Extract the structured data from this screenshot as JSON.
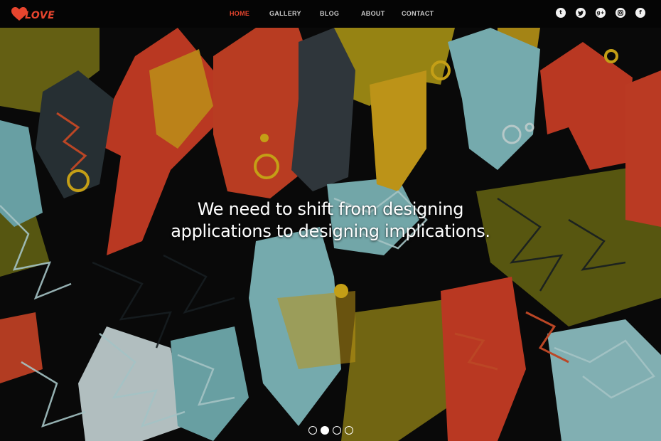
{
  "brand": {
    "logo_text": "LOVE"
  },
  "nav": {
    "items": [
      {
        "label": "HOME",
        "active": true
      },
      {
        "label": "GALLERY",
        "active": false
      },
      {
        "label": "BLOG",
        "active": false
      },
      {
        "label": "ABOUT",
        "active": false
      },
      {
        "label": "CONTACT",
        "active": false
      }
    ]
  },
  "socials": [
    {
      "icon": "tumblr-icon",
      "glyph": "t"
    },
    {
      "icon": "twitter-icon",
      "glyph": "🐦"
    },
    {
      "icon": "google-plus-icon",
      "glyph": "g+"
    },
    {
      "icon": "instagram-icon",
      "glyph": "◙"
    },
    {
      "icon": "facebook-icon",
      "glyph": "f"
    }
  ],
  "hero": {
    "quote_line1": "We need to shift from designing",
    "quote_line2": "applications to designing implications.",
    "slides_total": 4,
    "active_slide": 2
  },
  "colors": {
    "accent": "#e8452e",
    "graffiti_red": "#e2452a",
    "graffiti_yellow": "#c9a21a",
    "graffiti_cyan": "#8fd0d3",
    "graffiti_olive": "#7a7518"
  }
}
